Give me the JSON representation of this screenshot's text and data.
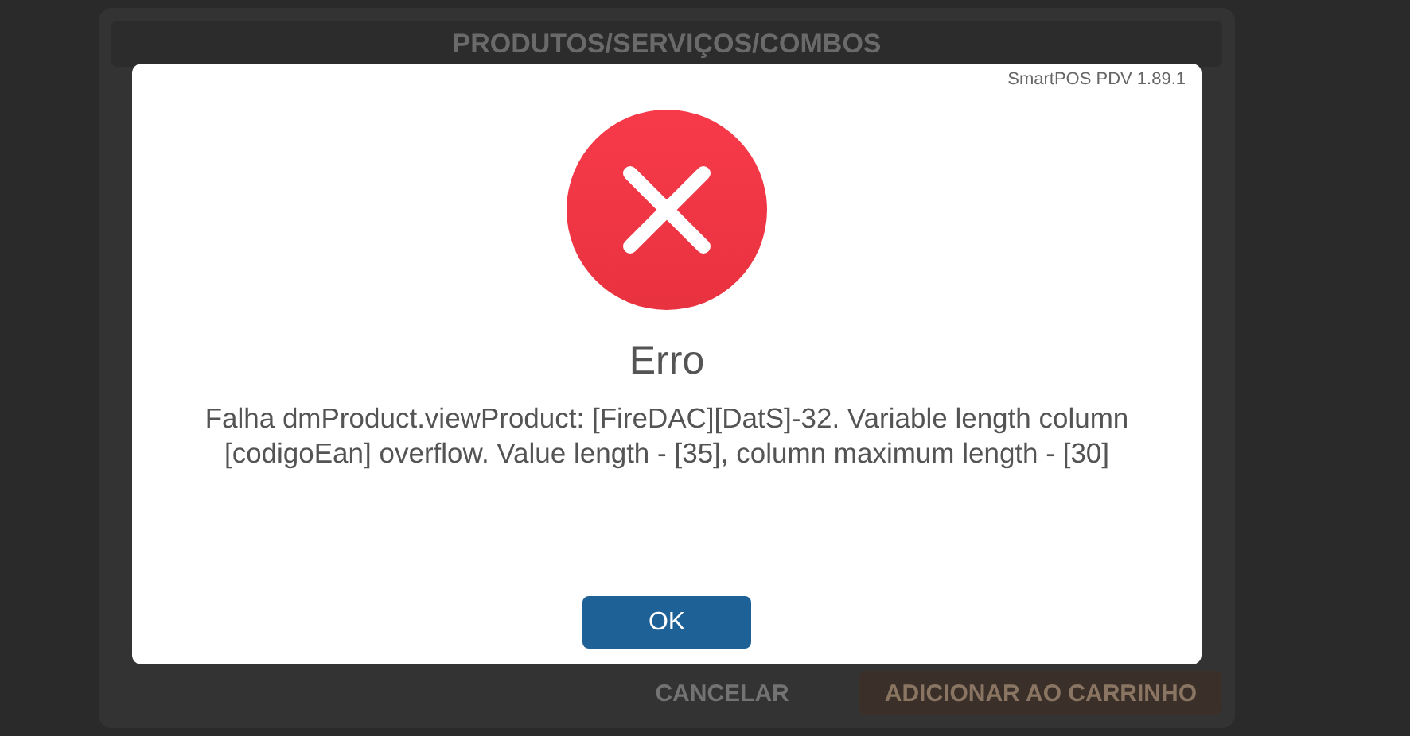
{
  "window": {
    "title": "PRODUTOS/SERVIÇOS/COMBOS"
  },
  "footer_buttons": [
    {
      "label": "CANCELAR",
      "kind": "plain"
    },
    {
      "label": "ADICIONAR AO CARRINHO",
      "kind": "primary"
    }
  ],
  "dialog": {
    "version": "SmartPOS PDV 1.89.1",
    "kind": "error",
    "title": "Erro",
    "message": "Falha dmProduct.viewProduct: [FireDAC][DatS]-32. Variable length column [codigoEan] overflow. Value length - [35], column maximum length - [30]",
    "button": "OK"
  }
}
